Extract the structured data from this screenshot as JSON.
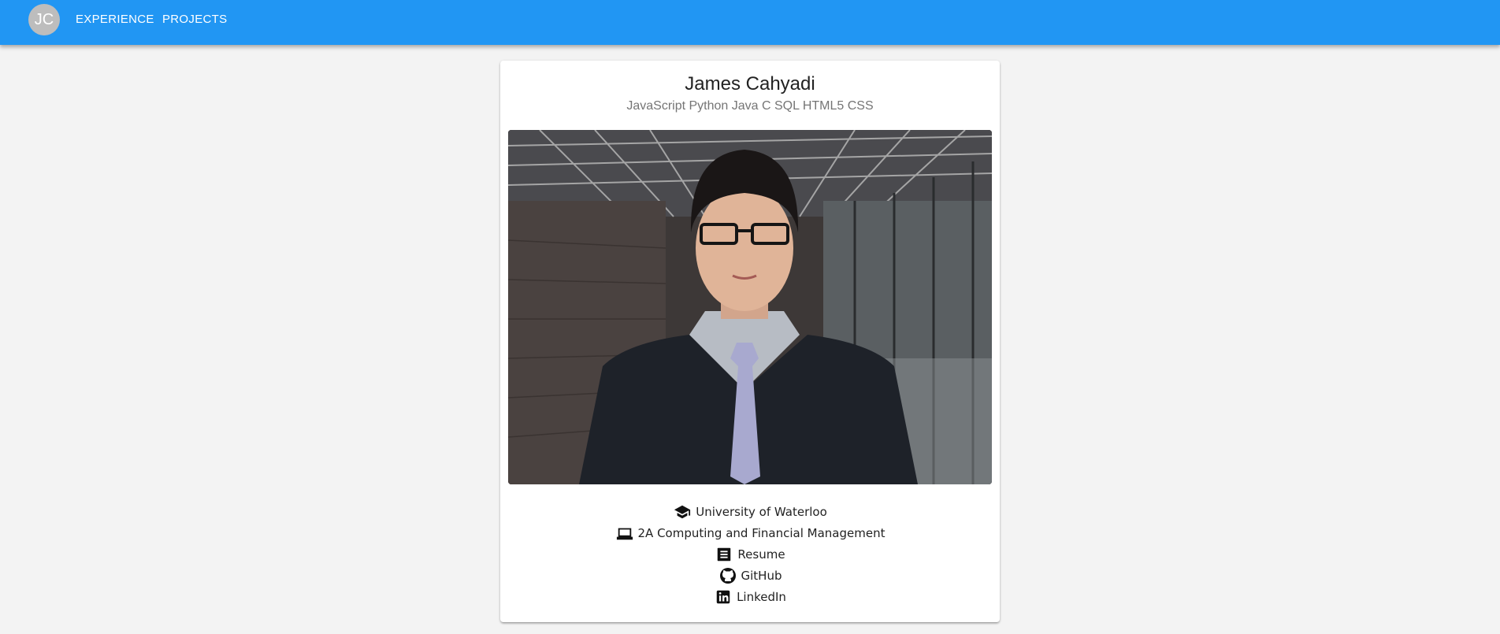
{
  "appbar": {
    "avatar_initials": "JC",
    "nav": [
      {
        "label": "EXPERIENCE"
      },
      {
        "label": "PROJECTS"
      }
    ],
    "color": "#2196f3"
  },
  "profile": {
    "name": "James Cahyadi",
    "skills": "JavaScript Python Java C SQL HTML5 CSS",
    "photo_icon": "profile-photo",
    "info": [
      {
        "icon": "graduation-cap-icon",
        "text": "University of Waterloo",
        "link": false
      },
      {
        "icon": "laptop-icon",
        "text": "2A Computing and Financial Management",
        "link": false
      },
      {
        "icon": "document-icon",
        "text": "Resume",
        "link": true
      },
      {
        "icon": "github-icon",
        "text": "GitHub",
        "link": true
      },
      {
        "icon": "linkedin-icon",
        "text": "LinkedIn",
        "link": true
      }
    ]
  }
}
